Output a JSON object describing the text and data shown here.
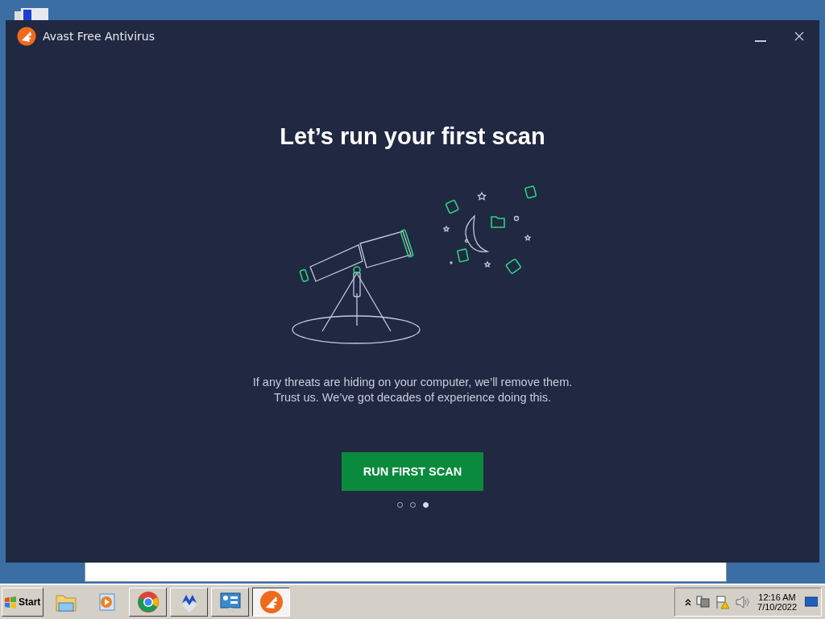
{
  "window": {
    "title": "Avast Free Antivirus"
  },
  "onboarding": {
    "heading": "Let’s run your first scan",
    "body_lines": [
      "If any threats are hiding on your computer, we’ll remove them.",
      "Trust us. We’ve got decades of experience doing this."
    ],
    "button": "RUN FIRST SCAN",
    "pager": [
      {
        "selected": false
      },
      {
        "selected": false
      },
      {
        "selected": true
      }
    ]
  },
  "taskbar": {
    "start": "Start",
    "buttons": [
      {
        "kind": "folder",
        "selected": false
      },
      {
        "kind": "media",
        "selected": false
      },
      {
        "kind": "chrome",
        "selected": false
      },
      {
        "kind": "malware",
        "selected": false
      },
      {
        "kind": "panel",
        "selected": false
      },
      {
        "kind": "avast",
        "selected": true
      }
    ],
    "clock": {
      "time": "12:16 AM",
      "date": "7/10/2022"
    }
  }
}
